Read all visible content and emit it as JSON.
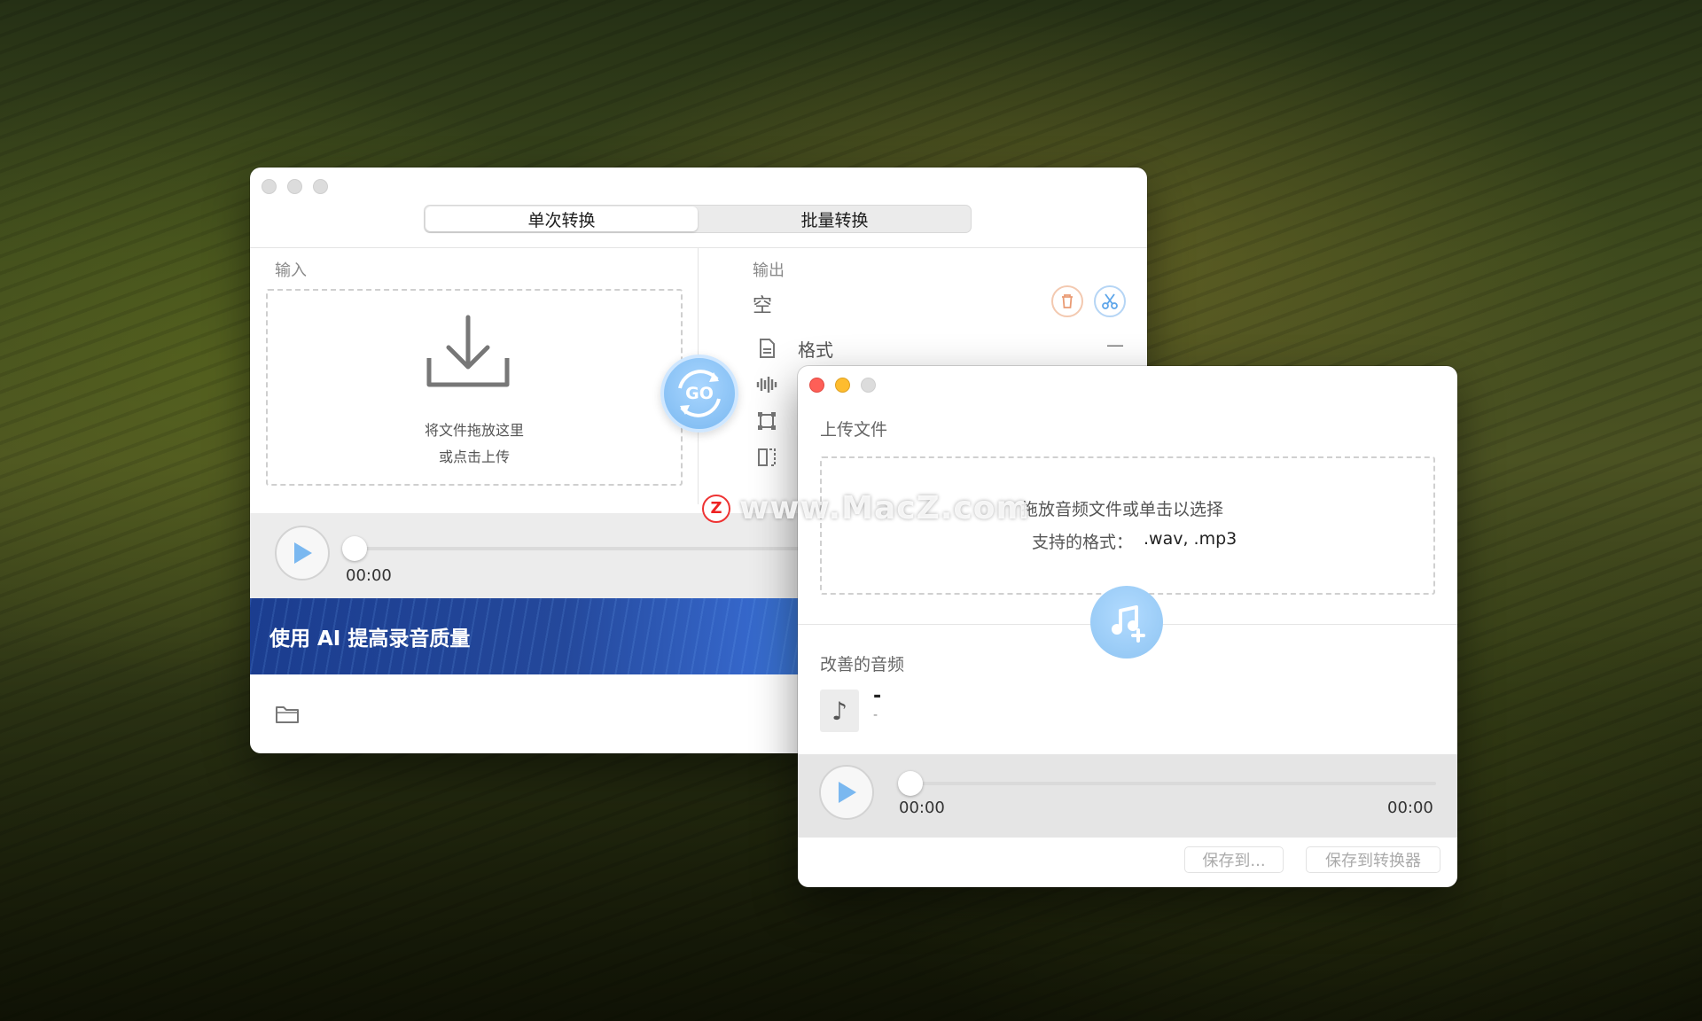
{
  "main_window": {
    "tabs": [
      "单次转换",
      "批量转换"
    ],
    "input_label": "输入",
    "drop_line1": "将文件拖放这里",
    "drop_line2": "或点击上传",
    "output_label": "输出",
    "output_empty": "空",
    "format_label": "格式",
    "format_value": "—",
    "player_time": "00:00",
    "banner_text": "使用 AI 提高录音质量",
    "go_label": "GO"
  },
  "front_window": {
    "upload_label": "上传文件",
    "upload_line1": "拖放音频文件或单击以选择",
    "upload_line2": "支持的格式：",
    "upload_formats": ".wav, .mp3",
    "improved_label": "改善的音频",
    "track_title": "-",
    "track_subtitle": "-",
    "time_start": "00:00",
    "time_end": "00:00",
    "save_to": "保存到...",
    "save_to_converter": "保存到转换器"
  },
  "watermark": "www.MacZ.com",
  "colors": {
    "accent_blue": "#7ab8f0",
    "close_red": "#fe5f57",
    "minimize_yellow": "#febc2e"
  },
  "icons": [
    "download-icon",
    "trash-icon",
    "scissors-icon",
    "document-icon",
    "waveform-icon",
    "crop-icon",
    "resize-icon",
    "play-icon",
    "folder-icon",
    "go-refresh-icon",
    "music-note-add-icon",
    "music-note-icon"
  ]
}
